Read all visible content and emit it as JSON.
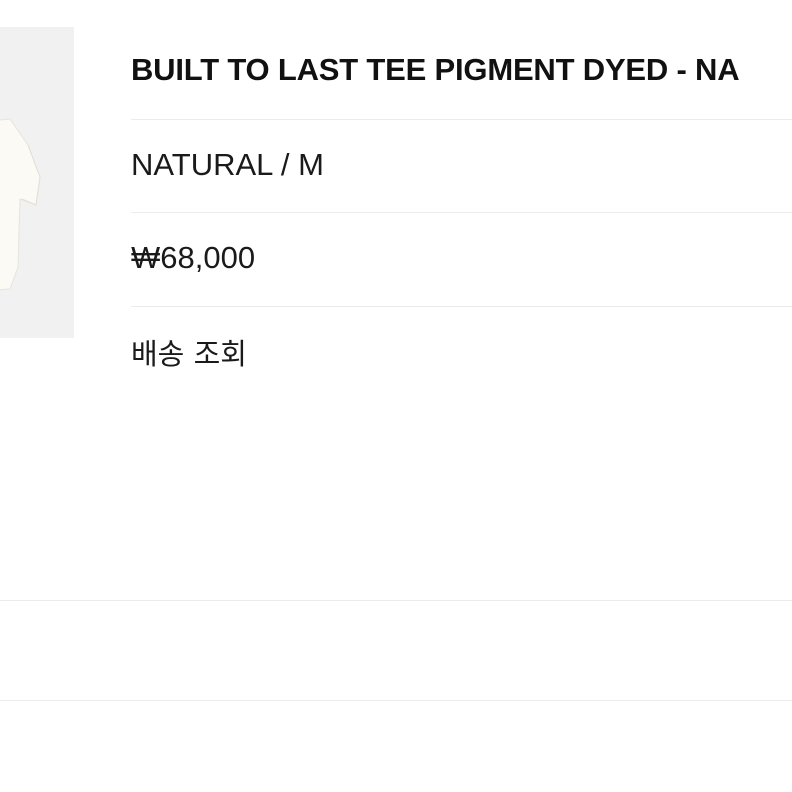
{
  "product": {
    "title": "BUILT TO LAST TEE PIGMENT DYED - NA",
    "option": "NATURAL / M",
    "price": "₩68,000",
    "shipping_link": "배송 조회"
  },
  "colors": {
    "thumbnail_bg": "#f1f1f1",
    "garment": "#fbfaf5",
    "divider": "#ececec",
    "text": "#111111"
  }
}
